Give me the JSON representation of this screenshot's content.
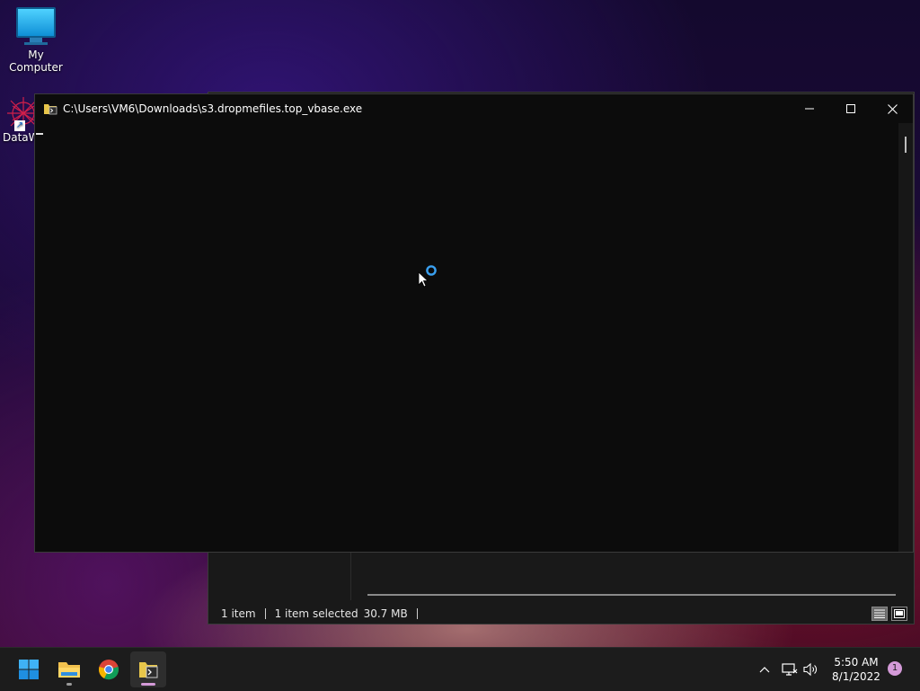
{
  "desktop": {
    "icons": [
      {
        "label": "My Computer"
      },
      {
        "label": "DataW"
      }
    ]
  },
  "explorer": {
    "status": {
      "item_count": "1 item",
      "selection": "1 item selected",
      "size": "30.7 MB"
    }
  },
  "console": {
    "title": "C:\\Users\\VM6\\Downloads\\s3.dropmefiles.top_vbase.exe",
    "controls": [
      "minimize-icon",
      "maximize-icon",
      "close-icon"
    ]
  },
  "taskbar": {
    "apps": [
      "windows-start-icon",
      "file-explorer-icon",
      "chrome-icon",
      "console-app-icon"
    ],
    "tray": [
      "chevron-up-icon",
      "network-icon",
      "volume-icon"
    ],
    "clock": {
      "time": "5:50 AM",
      "date": "8/1/2022"
    },
    "notification_count": "1"
  },
  "colors": {
    "accent": "#0078d4",
    "console_bg": "#0c0c0c",
    "taskbar_bg": "#1c1c1c",
    "notification_badge": "#d49ad8"
  }
}
